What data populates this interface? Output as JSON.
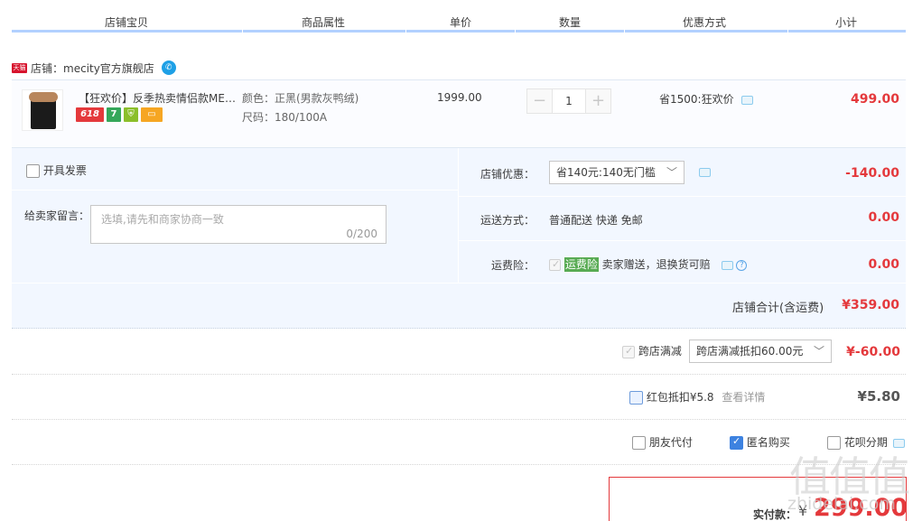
{
  "header": {
    "cols": [
      "店铺宝贝",
      "商品属性",
      "单价",
      "数量",
      "优惠方式",
      "小计"
    ]
  },
  "shop": {
    "badge": "天猫",
    "label": "店铺：mecity官方旗舰店",
    "ww": "✆"
  },
  "item": {
    "title": "【狂欢价】反季热卖情侣款MECITY男装冬季大毛领派克服男",
    "badges": [
      "618",
      "7",
      "",
      ""
    ],
    "color": "颜色：正黑(男款灰鸭绒)",
    "size": "尺码：180/100A",
    "price": "1999.00",
    "qty": "1",
    "minus": "−",
    "plus": "+",
    "promo": "省1500:狂欢价",
    "subtotal": "499.00"
  },
  "options": {
    "invoice": "开具发票",
    "message_label": "给卖家留言：",
    "message_placeholder": "选填,请先和商家协商一致",
    "message_count": "0/200",
    "shop_discount_label": "店铺优惠：",
    "shop_discount_value": "省140元:140无门槛",
    "shop_discount_amount": "-140.00",
    "shipping_label": "运送方式：",
    "shipping_value": "普通配送 快递 免邮",
    "shipping_amount": "0.00",
    "insurance_label": "运费险：",
    "insurance_tag": "运费险",
    "insurance_desc": "卖家赠送，退换货可赔",
    "insurance_amount": "0.00",
    "shop_total_label": "店铺合计(含运费)",
    "shop_total_amount": "¥359.00"
  },
  "cross": {
    "label": "跨店满减",
    "select": "跨店满减抵扣60.00元",
    "amount": "¥-60.00"
  },
  "redpacket": {
    "label": "红包抵扣¥5.8",
    "link": "查看详情",
    "amount": "¥5.80"
  },
  "pay_options": {
    "friend": "朋友代付",
    "anonymous": "匿名购买",
    "huabei": "花呗分期"
  },
  "pay": {
    "label": "实付款：",
    "currency": "¥",
    "amount": "299.00"
  },
  "watermark": {
    "mark": "值值值",
    "site": "zhidelai.com"
  },
  "colors": {
    "accent_red": "#e4393c",
    "header_line": "#b2d1ff",
    "panel_bg": "#f2f7ff"
  }
}
